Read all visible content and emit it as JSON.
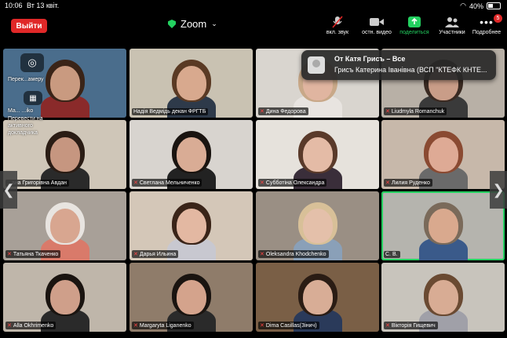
{
  "status": {
    "time": "10:06",
    "date": "Вт 13 квіт.",
    "battery": "40%",
    "battery_level": 0.4
  },
  "toolbar": {
    "leave": "Выйти",
    "title": "Zoom",
    "buttons": [
      {
        "label": "вкл. звук",
        "icon": "mic-muted-icon"
      },
      {
        "label": "остн. видео",
        "icon": "video-icon"
      },
      {
        "label": "поделиться",
        "icon": "share-icon"
      },
      {
        "label": "Участники",
        "icon": "participants-icon"
      },
      {
        "label": "Подробнее",
        "icon": "more-icon",
        "badge": "5"
      }
    ]
  },
  "notification": {
    "title": "От Катя Грисъ – Все",
    "message": "Грисъ Катерина Іванівна (ВСП \"КТЕФК КНТЕ..."
  },
  "overlay": {
    "switch_camera": "Перек...амеру",
    "raise": "Ma... ...iko",
    "note": "Перевести на активного докладчика"
  },
  "participants": [
    {
      "name": "",
      "muted": false
    },
    {
      "name": "Надія Ведмідь декан ФРГТБ",
      "muted": false
    },
    {
      "name": "Дина Федорова",
      "muted": true
    },
    {
      "name": "Liudmyla Romanchuk",
      "muted": true
    },
    {
      "name": "...ана Григорівна Авдан",
      "muted": false
    },
    {
      "name": "Светлана Мельниченко",
      "muted": true
    },
    {
      "name": "Субботіна Олександра",
      "muted": true
    },
    {
      "name": "Лилия Руденко",
      "muted": true
    },
    {
      "name": "Татьяна Ткаченко",
      "muted": true
    },
    {
      "name": "Дарья Ильина",
      "muted": true
    },
    {
      "name": "Oleksandra Khodchenko",
      "muted": true
    },
    {
      "name": "С. В.",
      "muted": false
    },
    {
      "name": "Alla Okhrimenko",
      "muted": true
    },
    {
      "name": "Margaryta Liganenko",
      "muted": true
    },
    {
      "name": "Dima Casillas(Зінич)",
      "muted": true
    },
    {
      "name": "Вікторія Гищевич",
      "muted": true
    }
  ]
}
